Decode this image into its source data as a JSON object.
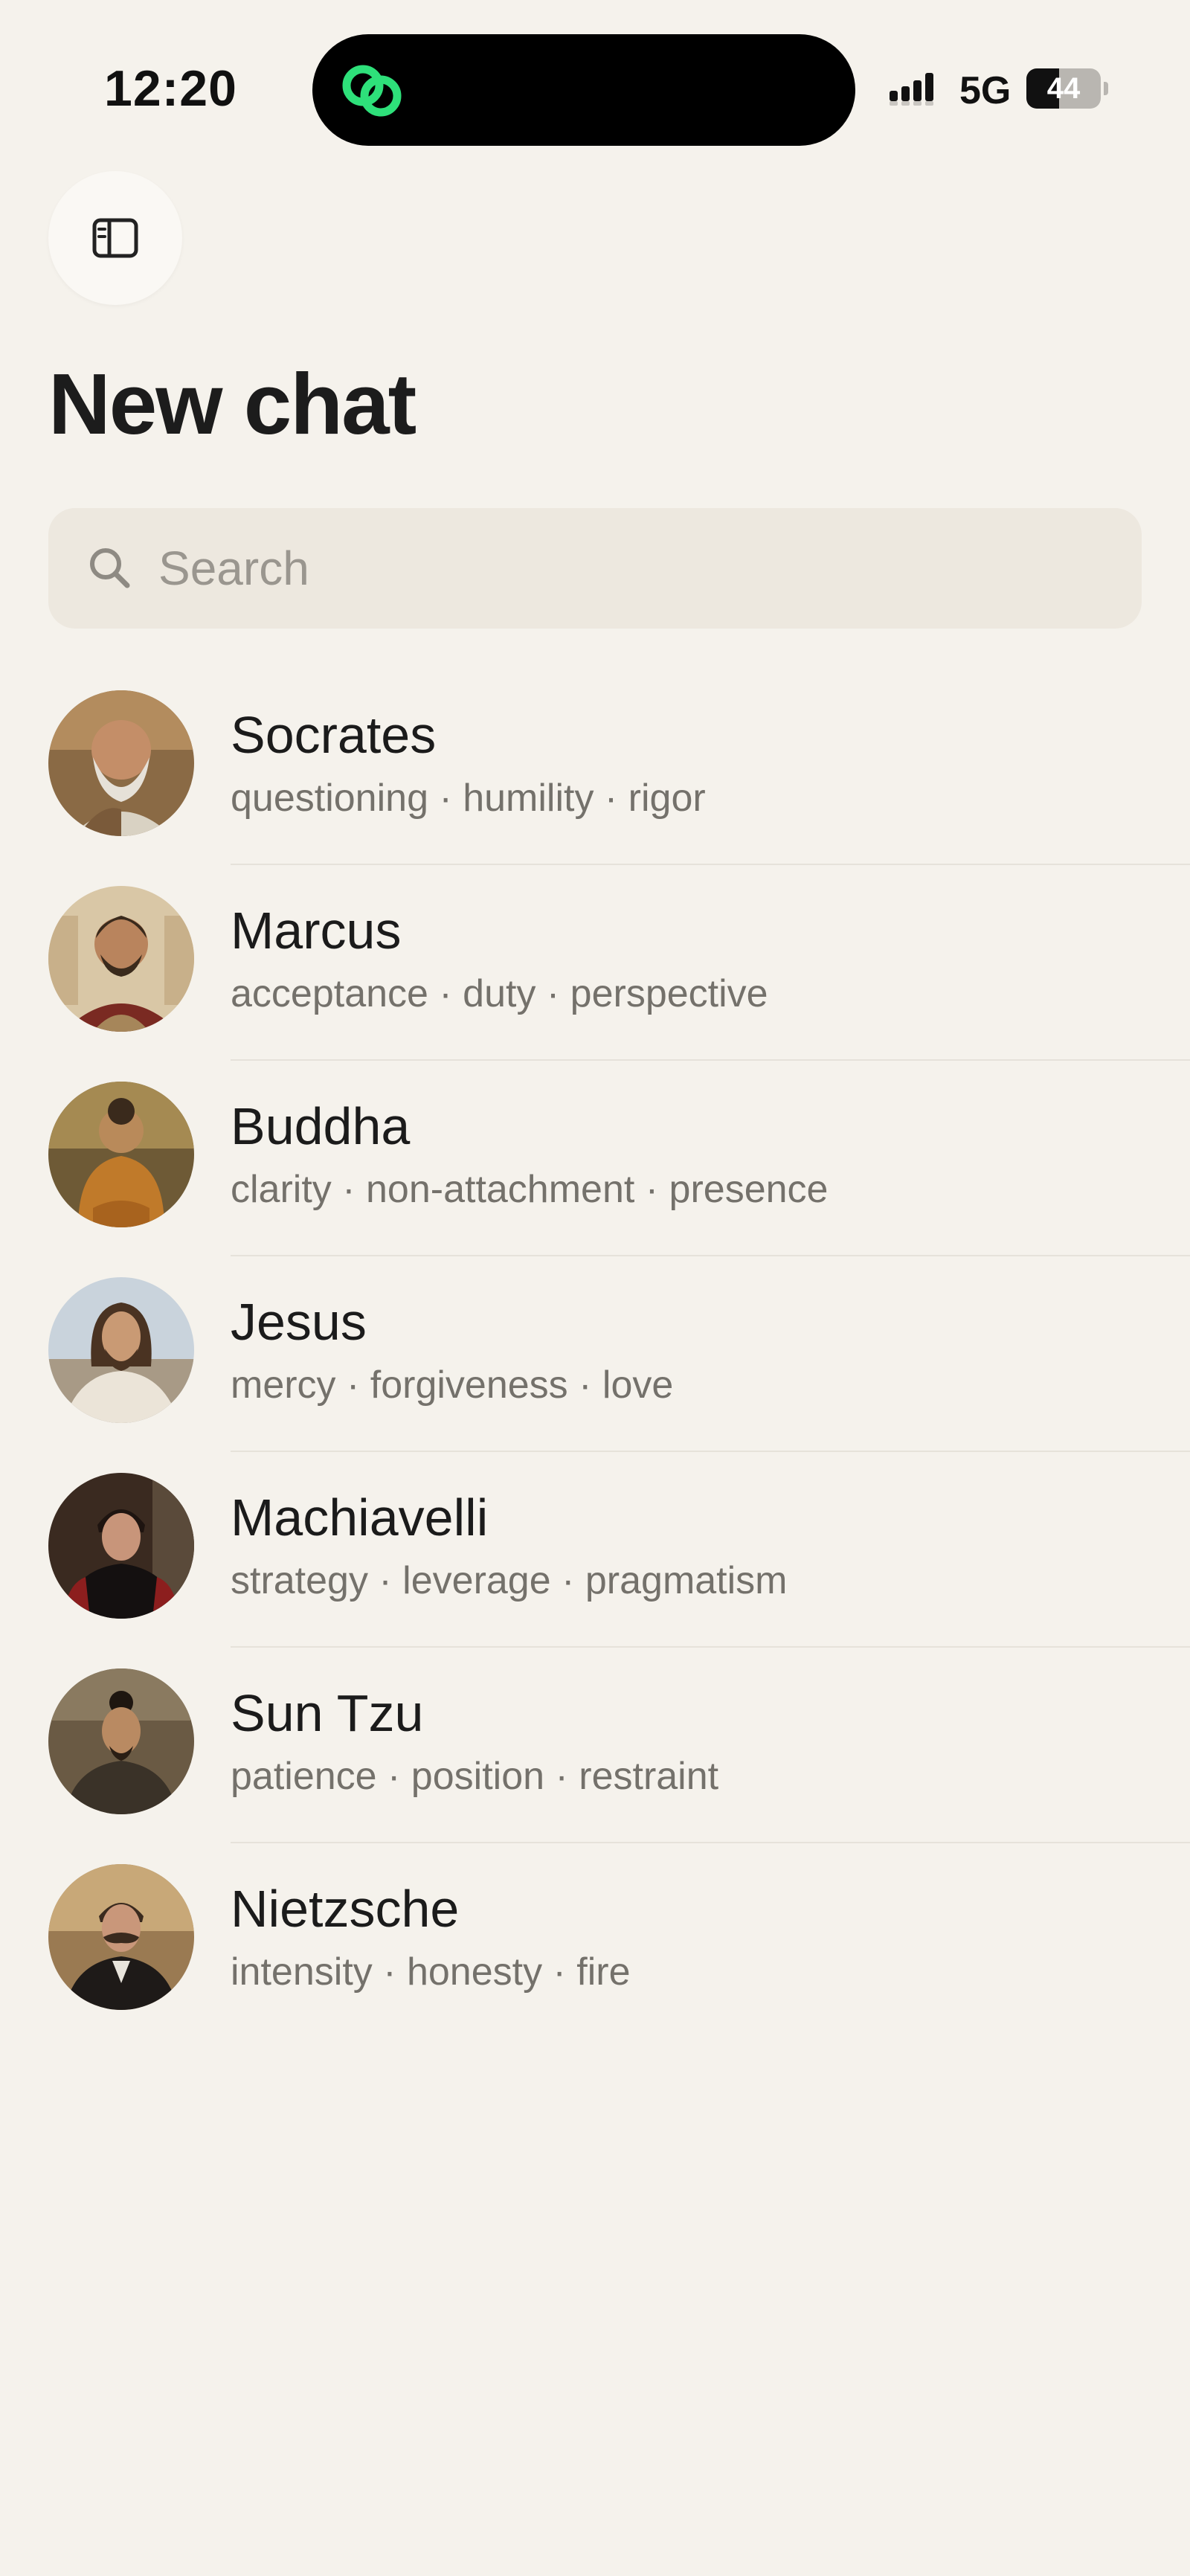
{
  "status_bar": {
    "time": "12:20",
    "network": "5G",
    "battery_level": "44",
    "battery_fraction": 0.44
  },
  "colors": {
    "background": "#f5f2ec",
    "search_background": "#ede8df",
    "island_icon": "#2ee07a",
    "primary_text": "#1b1b1b",
    "secondary_text": "#74716b"
  },
  "header": {
    "sidebar_icon": "sidebar-toggle-icon",
    "title": "New chat"
  },
  "search": {
    "icon": "search-icon",
    "placeholder": "Search",
    "value": ""
  },
  "personas": [
    {
      "name": "Socrates",
      "traits": "questioning · humility · rigor"
    },
    {
      "name": "Marcus",
      "traits": "acceptance · duty · perspective"
    },
    {
      "name": "Buddha",
      "traits": "clarity · non-attachment · presence"
    },
    {
      "name": "Jesus",
      "traits": "mercy · forgiveness · love"
    },
    {
      "name": "Machiavelli",
      "traits": "strategy · leverage · pragmatism"
    },
    {
      "name": "Sun Tzu",
      "traits": "patience · position · restraint"
    },
    {
      "name": "Nietzsche",
      "traits": "intensity · honesty · fire"
    }
  ]
}
